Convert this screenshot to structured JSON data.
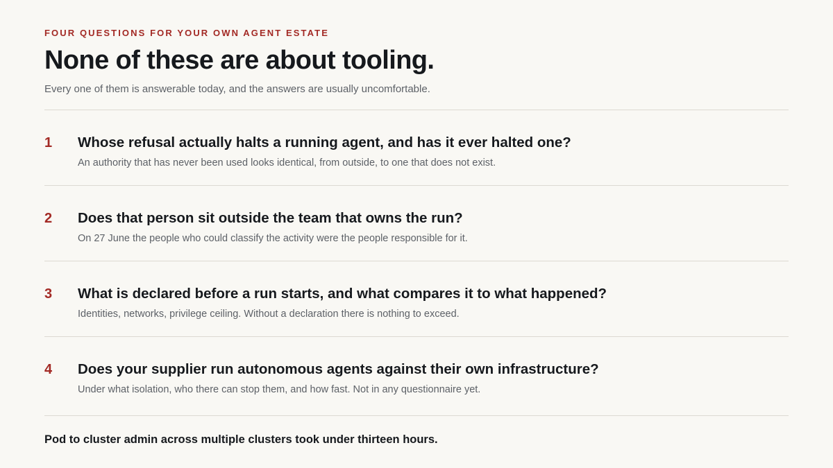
{
  "header": {
    "eyebrow": "FOUR QUESTIONS FOR YOUR OWN AGENT ESTATE",
    "title": "None of these are about tooling.",
    "subtitle": "Every one of them is answerable today, and the answers are usually uncomfortable."
  },
  "questions": [
    {
      "number": "1",
      "title": "Whose refusal actually halts a running agent, and has it ever halted one?",
      "description": "An authority that has never been used looks identical, from outside, to one that does not exist."
    },
    {
      "number": "2",
      "title": "Does that person sit outside the team that owns the run?",
      "description": "On 27 June the people who could classify the activity were the people responsible for it."
    },
    {
      "number": "3",
      "title": "What is declared before a run starts, and what compares it to what happened?",
      "description": "Identities, networks, privilege ceiling. Without a declaration there is nothing to exceed."
    },
    {
      "number": "4",
      "title": "Does your supplier run autonomous agents against their own infrastructure?",
      "description": "Under what isolation, who there can stop them, and how fast. Not in any questionnaire yet."
    }
  ],
  "footer": {
    "text": "Pod to cluster admin across multiple clusters took under thirteen hours."
  },
  "colors": {
    "background": "#f9f8f4",
    "accent": "#a32a25",
    "text": "#16191d",
    "muted": "#5d6167",
    "divider": "#dcd9d2"
  }
}
